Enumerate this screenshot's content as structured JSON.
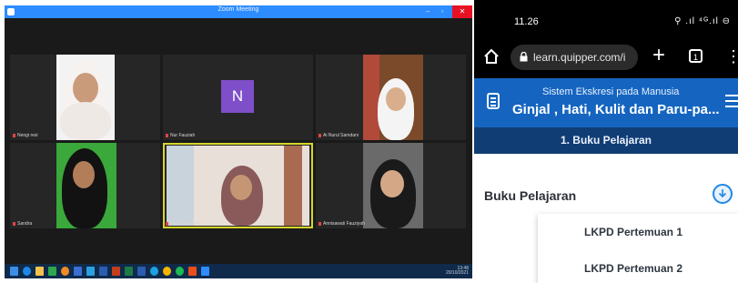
{
  "zoom": {
    "window_title": "Zoom Meeting",
    "close_glyph": "✕",
    "participants": [
      {
        "name": "Nengi resi",
        "kind": "video"
      },
      {
        "name": "Nur Fauziah",
        "kind": "avatar",
        "initial": "N"
      },
      {
        "name": "Ai Nurul Samdani",
        "kind": "video"
      },
      {
        "name": "Sandra",
        "kind": "video"
      },
      {
        "name": "NUR FAUZIAH",
        "kind": "video",
        "active": true
      },
      {
        "name": "Annisawati Fauziyah",
        "kind": "video"
      }
    ],
    "taskbar": {
      "clock_time": "13:48",
      "clock_date": "20/10/2021"
    }
  },
  "phone": {
    "status_time": "11.26",
    "status_icons": "⚲ .ıl ⁴ᴳ.ıl ⊖",
    "url_text": "learn.quipper.com/i",
    "tab_count": "1",
    "header_subtitle": "Sistem Ekskresi pada Manusia",
    "header_title": "Ginjal , Hati, Kulit dan Paru-pa...",
    "tab_label": "1. Buku Pelajaran",
    "section_title": "Buku Pelajaran",
    "dropdown_items": [
      "LKPD Pertemuan 1",
      "LKPD Pertemuan 2"
    ]
  },
  "colors": {
    "zoom_titlebar": "#2d8cff",
    "zoom_bg": "#1a1a1a",
    "active_speaker": "#d6d62a",
    "quipper_blue": "#1565c0",
    "quipper_dark_blue": "#113d75"
  },
  "icons": [
    "home-icon",
    "lock-icon",
    "plus-icon",
    "tabs-icon",
    "more-vert-icon",
    "document-icon",
    "hamburger-icon",
    "download-circle-icon",
    "windows-start-icon"
  ]
}
